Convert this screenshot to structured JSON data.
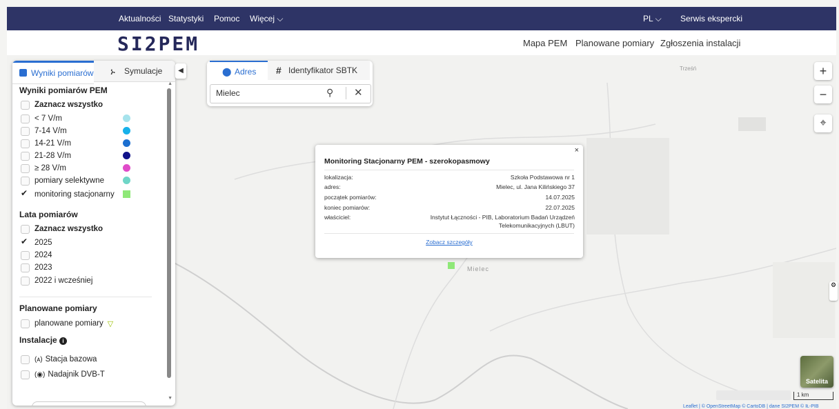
{
  "topbar": {
    "items": [
      "Aktualności",
      "Statystyki",
      "Pomoc",
      "Więcej"
    ],
    "lang": "PL",
    "expert": "Serwis ekspercki"
  },
  "header": {
    "logo": "SI2PEM",
    "nav": [
      "Mapa PEM",
      "Planowane pomiary",
      "Zgłoszenia instalacji"
    ]
  },
  "panel": {
    "tabs": [
      "Wyniki pomiarów",
      "Symulacje"
    ],
    "results_title": "Wyniki pomiarów PEM",
    "select_all": "Zaznacz wszystko",
    "levels": [
      {
        "label": "< 7 V/m",
        "color": "#a6e3ec"
      },
      {
        "label": "7-14 V/m",
        "color": "#17b1ea"
      },
      {
        "label": "14-21 V/m",
        "color": "#1c6fd0"
      },
      {
        "label": "21-28 V/m",
        "color": "#11128a"
      },
      {
        "label": "≥ 28 V/m",
        "color": "#e04bc9"
      },
      {
        "label": "pomiary selektywne",
        "color": "#6fd6c7"
      },
      {
        "label": "monitoring stacjonarny",
        "color": "#8fe878"
      }
    ],
    "years_title": "Lata pomiarów",
    "years_select_all": "Zaznacz wszystko",
    "years": [
      "2025",
      "2024",
      "2023",
      "2022 i wcześniej"
    ],
    "planned_title": "Planowane pomiary",
    "planned_item": "planowane pomiary",
    "install_title": "Instalacje",
    "installs": [
      "Stacja bazowa",
      "Nadajnik DVB-T"
    ]
  },
  "search": {
    "tabs": [
      "Adres",
      "Identyfikator SBTK"
    ],
    "value": "Mielec"
  },
  "popup": {
    "title": "Monitoring Stacjonarny PEM - szerokopasmowy",
    "rows": [
      {
        "label": "lokalizacja:",
        "value": "Szkoła Podstawowa nr 1"
      },
      {
        "label": "adres:",
        "value": "Mielec, ul. Jana Kilińskiego 37"
      },
      {
        "label": "początek pomiarów:",
        "value": "14.07.2025"
      },
      {
        "label": "koniec pomiarów:",
        "value": "22.07.2025"
      },
      {
        "label": "właściciel:",
        "value": "Instytut Łączności - PIB, Laboratorium Badań Urządzeń"
      },
      {
        "label": "",
        "value": "Telekomunikacyjnych (LBUT)"
      }
    ],
    "link": "Zobacz szczegóły",
    "close": "×"
  },
  "map": {
    "labels": [
      "Mielec",
      "Trześń"
    ],
    "scale": "1 km",
    "satellite": "Satelita",
    "attribution": "Leaflet | © OpenStreetMap © CartoDB | dane SI2PEM © IŁ-PIB"
  }
}
